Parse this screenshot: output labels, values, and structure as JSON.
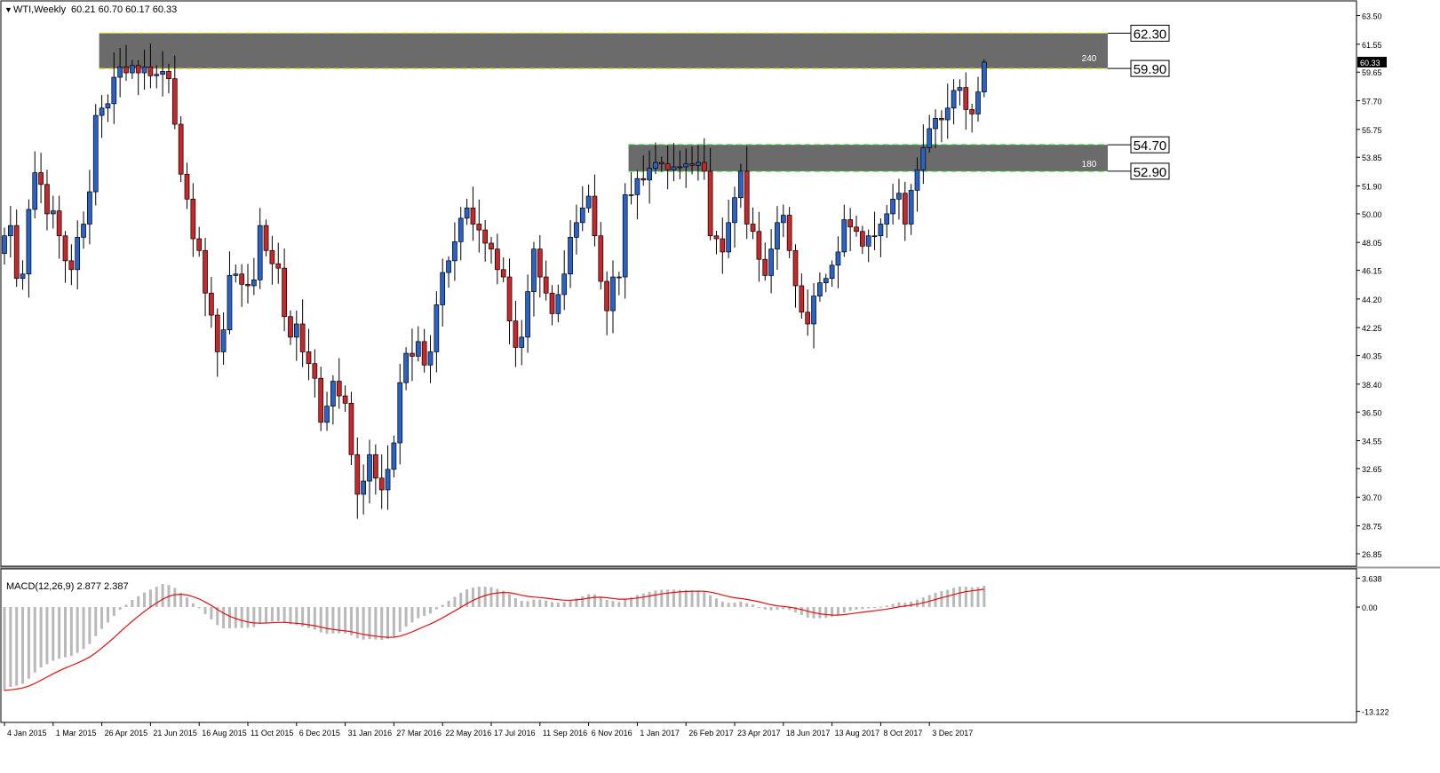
{
  "header": {
    "symbol_label": "WTI,Weekly",
    "ohlc_label": "60.21 60.70 60.17 60.33"
  },
  "colors": {
    "bull": "#2a63c8",
    "bear": "#c8282a",
    "zone": "#6b6b6b",
    "upper_zone_line": "#d6c800",
    "lower_zone_line": "#22c422",
    "macd_signal": "#e01010",
    "macd_hist": "#b9b9b9",
    "grid": "#000000"
  },
  "chart_data": [
    {
      "type": "candlestick",
      "title": "WTI,Weekly",
      "ylim": [
        26.0,
        64.5
      ],
      "y_ticks": [
        "63.50",
        "61.55",
        "59.65",
        "57.70",
        "55.75",
        "53.85",
        "51.90",
        "50.00",
        "48.05",
        "46.15",
        "44.20",
        "42.25",
        "40.35",
        "38.40",
        "36.50",
        "34.55",
        "32.65",
        "30.70",
        "28.75",
        "26.85"
      ],
      "current_price": "60.33",
      "x_ticks": [
        {
          "index": 0,
          "label": "4 Jan 2015"
        },
        {
          "index": 8,
          "label": "1 Mar 2015"
        },
        {
          "index": 16,
          "label": "26 Apr 2015"
        },
        {
          "index": 24,
          "label": "21 Jun 2015"
        },
        {
          "index": 32,
          "label": "16 Aug 2015"
        },
        {
          "index": 40,
          "label": "11 Oct 2015"
        },
        {
          "index": 48,
          "label": "6 Dec 2015"
        },
        {
          "index": 56,
          "label": "31 Jan 2016"
        },
        {
          "index": 64,
          "label": "27 Mar 2016"
        },
        {
          "index": 72,
          "label": "22 May 2016"
        },
        {
          "index": 80,
          "label": "17 Jul 2016"
        },
        {
          "index": 88,
          "label": "11 Sep 2016"
        },
        {
          "index": 96,
          "label": "6 Nov 2016"
        },
        {
          "index": 104,
          "label": "1 Jan 2017"
        },
        {
          "index": 112,
          "label": "26 Feb 2017"
        },
        {
          "index": 120,
          "label": "23 Apr 2017"
        },
        {
          "index": 128,
          "label": "18 Jun 2017"
        },
        {
          "index": 136,
          "label": "13 Aug 2017"
        },
        {
          "index": 144,
          "label": "8 Oct 2017"
        },
        {
          "index": 152,
          "label": "3 Dec 2017"
        }
      ],
      "zones": [
        {
          "name": "240",
          "low": 59.9,
          "high": 62.3,
          "start_index": 16,
          "low_label": "59.90",
          "high_label": "62.30"
        },
        {
          "name": "180",
          "low": 52.9,
          "high": 54.7,
          "start_index": 103,
          "low_label": "52.90",
          "high_label": "54.70"
        }
      ],
      "closes": [
        48.5,
        49.2,
        45.6,
        45.9,
        50.3,
        52.8,
        52.0,
        50.0,
        50.2,
        48.5,
        46.8,
        46.2,
        48.4,
        49.3,
        51.5,
        56.7,
        57.2,
        57.5,
        59.3,
        60.0,
        59.6,
        60.1,
        59.6,
        60.0,
        59.4,
        59.5,
        59.7,
        59.2,
        56.1,
        52.7,
        51.0,
        48.3,
        47.5,
        44.6,
        43.1,
        40.6,
        42.1,
        45.8,
        45.9,
        45.2,
        45.1,
        45.5,
        49.2,
        47.5,
        46.6,
        46.3,
        43.0,
        41.6,
        42.5,
        40.6,
        39.8,
        38.8,
        35.8,
        36.9,
        38.6,
        37.6,
        37.1,
        33.6,
        30.9,
        31.8,
        33.6,
        32.0,
        31.2,
        32.6,
        34.4,
        38.5,
        40.5,
        40.3,
        41.3,
        39.7,
        40.6,
        43.8,
        46.0,
        46.8,
        48.1,
        49.7,
        50.4,
        49.3,
        48.9,
        48.0,
        47.6,
        46.2,
        45.7,
        42.7,
        40.9,
        41.6,
        44.7,
        47.6,
        45.7,
        44.6,
        43.2,
        44.5,
        45.9,
        48.4,
        49.4,
        50.4,
        51.2,
        48.5,
        45.4,
        43.4,
        45.7,
        45.7,
        51.3,
        51.3,
        52.4,
        52.3,
        53.1,
        53.5,
        53.4,
        53.0,
        53.2,
        53.2,
        53.4,
        53.3,
        53.5,
        52.9,
        48.5,
        48.3,
        47.4,
        49.4,
        51.1,
        52.9,
        49.3,
        48.8,
        46.9,
        45.8,
        47.6,
        49.4,
        49.9,
        47.5,
        45.1,
        43.3,
        42.5,
        44.4,
        45.3,
        45.6,
        46.5,
        47.4,
        49.6,
        49.1,
        48.8,
        47.8,
        48.5,
        48.5,
        49.3,
        50.0,
        51.0,
        51.4,
        49.3,
        51.6,
        53.0,
        54.5,
        55.8,
        56.5,
        56.4,
        57.2,
        58.4,
        58.6,
        57.1,
        56.8,
        58.3,
        60.33
      ]
    },
    {
      "type": "macd",
      "title": "MACD(12,26,9) 2.877 2.387",
      "ylim": [
        -14.5,
        4.8
      ],
      "y_ticks": [
        "3.638",
        "0.00",
        "-13.122"
      ]
    }
  ]
}
